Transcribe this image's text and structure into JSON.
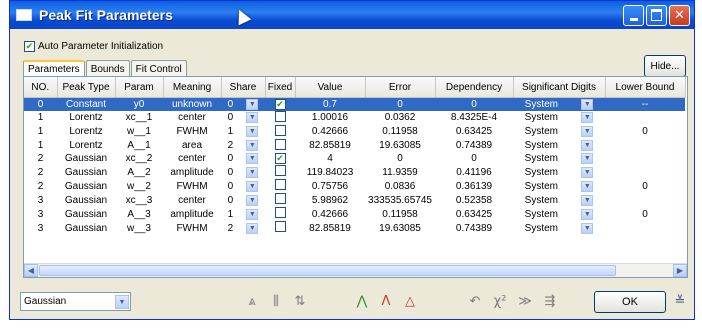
{
  "window": {
    "title": "Peak Fit Parameters"
  },
  "auto_param": {
    "label": "Auto Parameter Initialization",
    "checked": true
  },
  "tabs": [
    "Parameters",
    "Bounds",
    "Fit Control"
  ],
  "hide_button": "Hide...",
  "table": {
    "columns": [
      "NO.",
      "Peak Type",
      "Param",
      "Meaning",
      "Share",
      "Fixed",
      "Value",
      "Error",
      "Dependency",
      "Significant Digits",
      "Lower Bound"
    ],
    "rows": [
      {
        "no": "0",
        "type": "Constant",
        "param": "y0",
        "meaning": "unknown",
        "share": "0",
        "fixed": true,
        "value": "0.7",
        "error": "0",
        "dep": "0",
        "sig": "System",
        "lower": "--",
        "selected": true
      },
      {
        "no": "1",
        "type": "Lorentz",
        "param": "xc__1",
        "meaning": "center",
        "share": "0",
        "fixed": false,
        "value": "1.00016",
        "error": "0.0362",
        "dep": "8.4325E-4",
        "sig": "System",
        "lower": ""
      },
      {
        "no": "1",
        "type": "Lorentz",
        "param": "w__1",
        "meaning": "FWHM",
        "share": "1",
        "fixed": false,
        "value": "0.42666",
        "error": "0.11958",
        "dep": "0.63425",
        "sig": "System",
        "lower": "0"
      },
      {
        "no": "1",
        "type": "Lorentz",
        "param": "A__1",
        "meaning": "area",
        "share": "2",
        "fixed": false,
        "value": "82.85819",
        "error": "19.63085",
        "dep": "0.74389",
        "sig": "System",
        "lower": ""
      },
      {
        "no": "2",
        "type": "Gaussian",
        "param": "xc__2",
        "meaning": "center",
        "share": "0",
        "fixed": true,
        "value": "4",
        "error": "0",
        "dep": "0",
        "sig": "System",
        "lower": ""
      },
      {
        "no": "2",
        "type": "Gaussian",
        "param": "A__2",
        "meaning": "amplitude",
        "share": "0",
        "fixed": false,
        "value": "119.84023",
        "error": "11.9359",
        "dep": "0.41196",
        "sig": "System",
        "lower": ""
      },
      {
        "no": "2",
        "type": "Gaussian",
        "param": "w__2",
        "meaning": "FWHM",
        "share": "0",
        "fixed": false,
        "value": "0.75756",
        "error": "0.0836",
        "dep": "0.36139",
        "sig": "System",
        "lower": "0"
      },
      {
        "no": "3",
        "type": "Gaussian",
        "param": "xc__3",
        "meaning": "center",
        "share": "0",
        "fixed": false,
        "value": "5.98962",
        "error": "333535.65745",
        "dep": "0.52358",
        "sig": "System",
        "lower": ""
      },
      {
        "no": "3",
        "type": "Gaussian",
        "param": "A__3",
        "meaning": "amplitude",
        "share": "1",
        "fixed": false,
        "value": "0.42666",
        "error": "0.11958",
        "dep": "0.63425",
        "sig": "System",
        "lower": "0"
      },
      {
        "no": "3",
        "type": "Gaussian",
        "param": "w__3",
        "meaning": "FWHM",
        "share": "2",
        "fixed": false,
        "value": "82.85819",
        "error": "19.63085",
        "dep": "0.74389",
        "sig": "System",
        "lower": ""
      }
    ]
  },
  "bottom": {
    "function_select": "Gaussian",
    "ok_label": "OK"
  },
  "colors": {
    "title_bar": "#0a5fe0",
    "selection": "#316ac5",
    "dialog_bg": "#ece9d8"
  }
}
